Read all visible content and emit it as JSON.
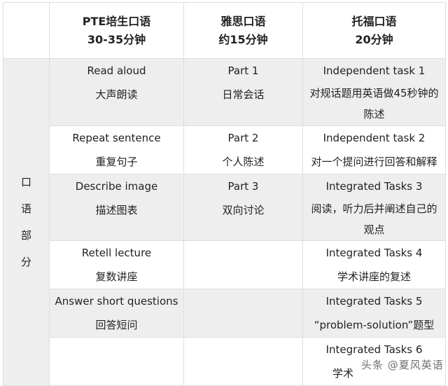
{
  "header": {
    "corner": "",
    "columns": [
      {
        "title": "PTE培生口语",
        "duration": "30-35分钟"
      },
      {
        "title": "雅思口语",
        "duration": "约15分钟"
      },
      {
        "title": "托福口语",
        "duration": "20分钟"
      }
    ]
  },
  "side_label": [
    "口",
    "语",
    "部",
    "分"
  ],
  "rows": [
    {
      "pte_en": "Read aloud",
      "pte_cn": "大声朗读",
      "ielts_en": "Part 1",
      "ielts_cn": "日常会话",
      "toefl_en": "Independent task 1",
      "toefl_cn": "对规话题用英语做45秒钟的陈述"
    },
    {
      "pte_en": "Repeat sentence",
      "pte_cn": "重复句子",
      "ielts_en": "Part 2",
      "ielts_cn": "个人陈述",
      "toefl_en": "Independent task 2",
      "toefl_cn": "对一个提问进行回答和解释"
    },
    {
      "pte_en": "Describe image",
      "pte_cn": "描述图表",
      "ielts_en": "Part 3",
      "ielts_cn": "双向讨论",
      "toefl_en": "Integrated Tasks 3",
      "toefl_cn": "阅读，听力后并阐述自己的观点"
    },
    {
      "pte_en": "Retell lecture",
      "pte_cn": "复数讲座",
      "ielts_en": "",
      "ielts_cn": "",
      "toefl_en": "Integrated Tasks 4",
      "toefl_cn": "学术讲座的复述"
    },
    {
      "pte_en": "Answer short questions",
      "pte_cn": "回答短问",
      "ielts_en": "",
      "ielts_cn": "",
      "toefl_en": "Integrated Tasks 5",
      "toefl_cn": "“problem-solution”题型"
    },
    {
      "pte_en": "",
      "pte_cn": "",
      "ielts_en": "",
      "ielts_cn": "",
      "toefl_en": "Integrated Tasks 6",
      "toefl_cn": "学术"
    }
  ],
  "watermark": "头条 @夏风英语"
}
